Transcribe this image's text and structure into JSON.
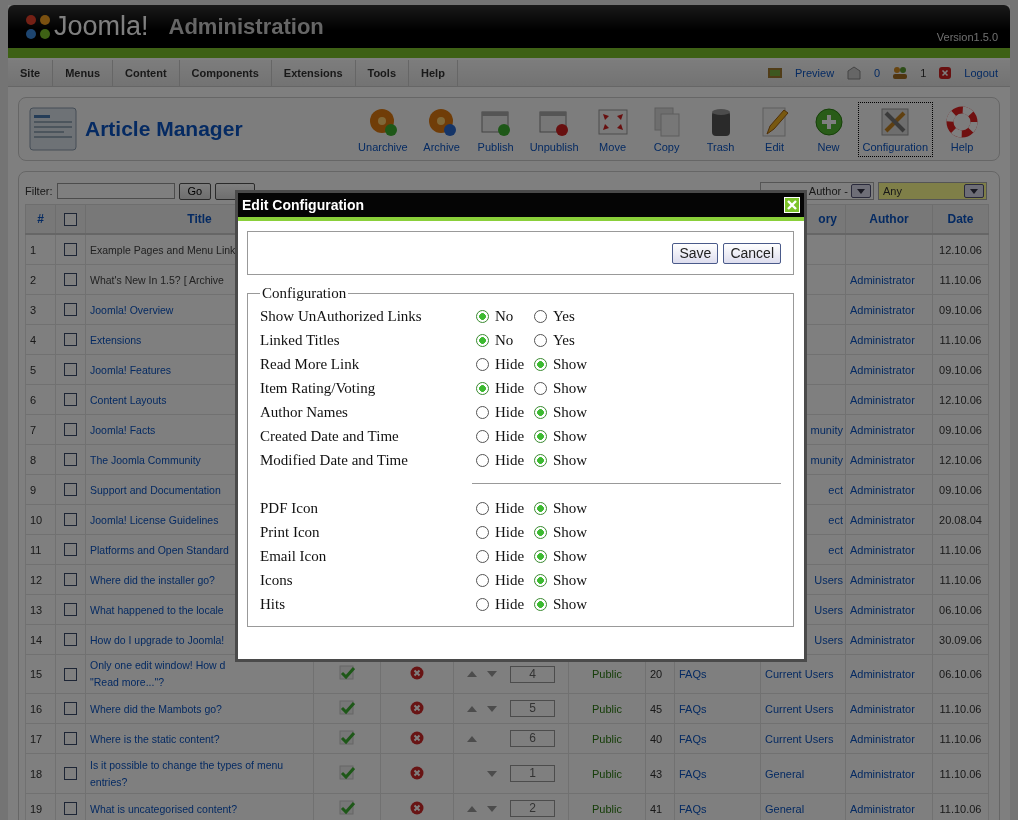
{
  "header": {
    "logo": "Joomla!",
    "title": "Administration",
    "version": "Version1.5.0"
  },
  "menu": [
    "Site",
    "Menus",
    "Content",
    "Components",
    "Extensions",
    "Tools",
    "Help"
  ],
  "status": {
    "preview": "Preview",
    "messages": "0",
    "users": "1",
    "logout": "Logout"
  },
  "toolbar": {
    "title": "Article Manager",
    "buttons": [
      {
        "kind": "unarchive",
        "label": "Unarchive",
        "selected": false
      },
      {
        "kind": "archive",
        "label": "Archive",
        "selected": false
      },
      {
        "kind": "publish",
        "label": "Publish",
        "selected": false
      },
      {
        "kind": "unpublish",
        "label": "Unpublish",
        "selected": false
      },
      {
        "kind": "move",
        "label": "Move",
        "selected": false
      },
      {
        "kind": "copy",
        "label": "Copy",
        "selected": false
      },
      {
        "kind": "trash",
        "label": "Trash",
        "selected": false
      },
      {
        "kind": "edit",
        "label": "Edit",
        "selected": false
      },
      {
        "kind": "new",
        "label": "New",
        "selected": false
      },
      {
        "kind": "configuration",
        "label": "Configuration",
        "selected": true
      },
      {
        "kind": "help",
        "label": "Help",
        "selected": false
      }
    ]
  },
  "filter": {
    "label": "Filter:",
    "go": "Go",
    "author_select": "Author -",
    "any_select": "Any"
  },
  "table": {
    "columns": {
      "number": "#",
      "title": "Title",
      "category": "ory",
      "author": "Author",
      "date": "Date"
    },
    "select_all_checked": false,
    "rows": [
      {
        "number": "1",
        "checked": false,
        "title": "Example Pages and Menu Link",
        "linked": false,
        "date": "12.10.06"
      },
      {
        "number": "2",
        "checked": false,
        "title": "What's New In 1.5? [ Archive",
        "linked": false,
        "author": "Administrator",
        "date": "11.10.06"
      },
      {
        "number": "3",
        "checked": false,
        "title": "Joomla! Overview",
        "linked": true,
        "author": "Administrator",
        "date": "09.10.06"
      },
      {
        "number": "4",
        "checked": false,
        "title": "Extensions",
        "linked": true,
        "author": "Administrator",
        "date": "11.10.06"
      },
      {
        "number": "5",
        "checked": false,
        "title": "Joomla! Features",
        "linked": true,
        "author": "Administrator",
        "date": "09.10.06"
      },
      {
        "number": "6",
        "checked": false,
        "title": "Content Layouts",
        "linked": true,
        "author": "Administrator",
        "date": "12.10.06"
      },
      {
        "number": "7",
        "checked": false,
        "title": "Joomla! Facts",
        "linked": true,
        "category": "munity",
        "author": "Administrator",
        "date": "09.10.06"
      },
      {
        "number": "8",
        "checked": false,
        "title": "The Joomla Community",
        "linked": true,
        "category": "munity",
        "author": "Administrator",
        "date": "12.10.06"
      },
      {
        "number": "9",
        "checked": false,
        "title": "Support and Documentation",
        "linked": true,
        "category": "ect",
        "author": "Administrator",
        "date": "09.10.06"
      },
      {
        "number": "10",
        "checked": false,
        "title": "Joomla! License Guidelines",
        "linked": true,
        "category": "ect",
        "author": "Administrator",
        "date": "20.08.04"
      },
      {
        "number": "11",
        "checked": false,
        "title": "Platforms and Open Standard",
        "linked": true,
        "category": "ect",
        "author": "Administrator",
        "date": "11.10.06"
      },
      {
        "number": "12",
        "checked": false,
        "title": "Where did the installer go?",
        "linked": true,
        "category": "Users",
        "author": "Administrator",
        "date": "11.10.06"
      },
      {
        "number": "13",
        "checked": false,
        "title": "What happened to the locale",
        "linked": true,
        "category": "Users",
        "author": "Administrator",
        "date": "06.10.06"
      },
      {
        "number": "14",
        "checked": false,
        "title": "How do I upgrade to Joomla!",
        "linked": true,
        "category": "Users",
        "author": "Administrator",
        "date": "30.09.06"
      },
      {
        "number": "15",
        "checked": false,
        "title_lines": [
          "Only one edit window! How d",
          "\"Read more...\"?"
        ],
        "linked": true,
        "published": true,
        "front_page": false,
        "order_up": true,
        "order_down": true,
        "order": "4",
        "access": "Public",
        "id": "20",
        "section": "FAQs",
        "category": "Current Users",
        "author": "Administrator",
        "date": "06.10.06"
      },
      {
        "number": "16",
        "checked": false,
        "title": "Where did the Mambots go?",
        "linked": true,
        "published": true,
        "front_page": false,
        "order_up": true,
        "order_down": true,
        "order": "5",
        "access": "Public",
        "id": "45",
        "section": "FAQs",
        "category": "Current Users",
        "author": "Administrator",
        "date": "11.10.06"
      },
      {
        "number": "17",
        "checked": false,
        "title": "Where is the static content?",
        "linked": true,
        "published": true,
        "front_page": false,
        "order_up": true,
        "order_down": false,
        "order": "6",
        "access": "Public",
        "id": "40",
        "section": "FAQs",
        "category": "Current Users",
        "author": "Administrator",
        "date": "11.10.06"
      },
      {
        "number": "18",
        "checked": false,
        "title_lines": [
          "Is it possible to change the types of menu",
          "entries?"
        ],
        "linked": true,
        "published": true,
        "front_page": false,
        "order_up": false,
        "order_down": true,
        "order": "1",
        "access": "Public",
        "id": "43",
        "section": "FAQs",
        "category": "General",
        "author": "Administrator",
        "date": "11.10.06"
      },
      {
        "number": "19",
        "checked": false,
        "title": "What is uncategorised content?",
        "linked": true,
        "published": true,
        "front_page": false,
        "order_up": true,
        "order_down": true,
        "order": "2",
        "access": "Public",
        "id": "41",
        "section": "FAQs",
        "category": "General",
        "author": "Administrator",
        "date": "11.10.06"
      }
    ]
  },
  "modal": {
    "title": "Edit Configuration",
    "buttons": [
      "Save",
      "Cancel"
    ],
    "legend": "Configuration",
    "sections": [
      {
        "items": [
          {
            "label": "Show UnAuthorized Links",
            "options": [
              {
                "label": "No",
                "selected": true
              },
              {
                "label": "Yes",
                "selected": false
              }
            ]
          },
          {
            "label": "Linked Titles",
            "options": [
              {
                "label": "No",
                "selected": true
              },
              {
                "label": "Yes",
                "selected": false
              }
            ]
          },
          {
            "label": "Read More Link",
            "options": [
              {
                "label": "Hide",
                "selected": false
              },
              {
                "label": "Show",
                "selected": true
              }
            ]
          },
          {
            "label": "Item Rating/Voting",
            "options": [
              {
                "label": "Hide",
                "selected": true
              },
              {
                "label": "Show",
                "selected": false
              }
            ]
          },
          {
            "label": "Author Names",
            "options": [
              {
                "label": "Hide",
                "selected": false
              },
              {
                "label": "Show",
                "selected": true
              }
            ]
          },
          {
            "label": "Created Date and Time",
            "options": [
              {
                "label": "Hide",
                "selected": false
              },
              {
                "label": "Show",
                "selected": true
              }
            ]
          },
          {
            "label": "Modified Date and Time",
            "options": [
              {
                "label": "Hide",
                "selected": false
              },
              {
                "label": "Show",
                "selected": true
              }
            ]
          }
        ]
      },
      {
        "items": [
          {
            "label": "PDF Icon",
            "options": [
              {
                "label": "Hide",
                "selected": false
              },
              {
                "label": "Show",
                "selected": true
              }
            ]
          },
          {
            "label": "Print Icon",
            "options": [
              {
                "label": "Hide",
                "selected": false
              },
              {
                "label": "Show",
                "selected": true
              }
            ]
          },
          {
            "label": "Email Icon",
            "options": [
              {
                "label": "Hide",
                "selected": false
              },
              {
                "label": "Show",
                "selected": true
              }
            ]
          },
          {
            "label": "Icons",
            "options": [
              {
                "label": "Hide",
                "selected": false
              },
              {
                "label": "Show",
                "selected": true
              }
            ]
          },
          {
            "label": "Hits",
            "options": [
              {
                "label": "Hide",
                "selected": false
              },
              {
                "label": "Show",
                "selected": true
              }
            ]
          }
        ]
      }
    ]
  }
}
